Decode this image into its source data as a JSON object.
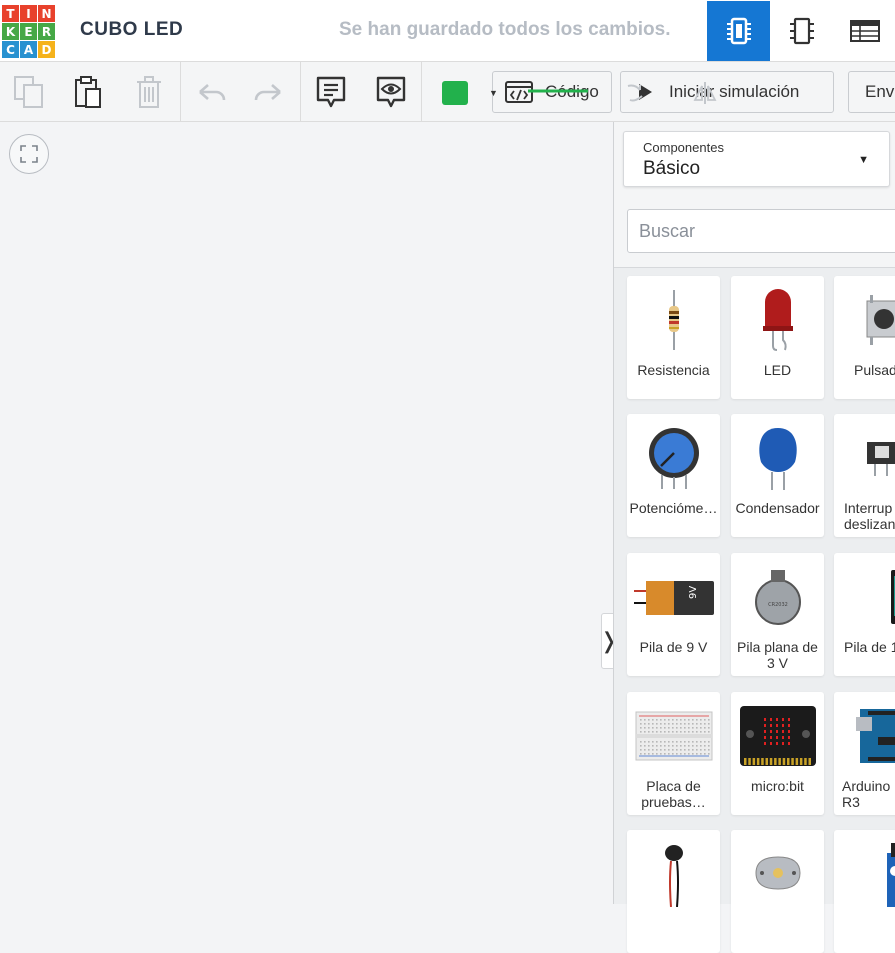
{
  "app": {
    "logo_letters": [
      "T",
      "I",
      "N",
      "K",
      "E",
      "R",
      "C",
      "A",
      "D"
    ],
    "logo_colors": [
      "#e8412c",
      "#e8412c",
      "#e8412c",
      "#46a846",
      "#46a846",
      "#46a846",
      "#2891d0",
      "#2891d0",
      "#f5b21b"
    ],
    "title": "CUBO LED",
    "save_status": "Se han guardado todos los cambios.",
    "accent": "#1577d3"
  },
  "view_switcher": [
    {
      "icon": "circuit-chip-icon",
      "active": true
    },
    {
      "icon": "schematic-icon",
      "active": false
    },
    {
      "icon": "component-list-icon",
      "active": false
    }
  ],
  "toolbar": {
    "copy_icon": "copy-icon",
    "paste_icon": "paste-icon",
    "delete_icon": "trash-icon",
    "undo_icon": "undo-icon",
    "redo_icon": "redo-icon",
    "notes_icon": "notes-icon",
    "visibility_icon": "eye-icon",
    "wire_color": "#22b14c",
    "code_label": "Código",
    "simulate_label": "Iniciar simulación",
    "send_label": "Env"
  },
  "panel": {
    "components_label": "Componentes",
    "category": "Básico",
    "search_placeholder": "Buscar"
  },
  "components": [
    {
      "name": "Resistencia",
      "icon": "resistor-icon"
    },
    {
      "name": "LED",
      "icon": "led-icon"
    },
    {
      "name": "Pulsad",
      "icon": "pushbutton-icon"
    },
    {
      "name": "Potencióme…",
      "icon": "potentiometer-icon"
    },
    {
      "name": "Condensador",
      "icon": "capacitor-icon"
    },
    {
      "name": "Interrup\ndeslizan",
      "icon": "slide-switch-icon"
    },
    {
      "name": "Pila de 9 V",
      "icon": "battery-9v-icon"
    },
    {
      "name": "Pila plana de\n3 V",
      "icon": "coin-cell-icon"
    },
    {
      "name": "Pila de 1",
      "icon": "battery-aa-icon"
    },
    {
      "name": "Placa de\npruebas…",
      "icon": "breadboard-icon"
    },
    {
      "name": "micro:bit",
      "icon": "microbit-icon"
    },
    {
      "name": "Arduino\nR3",
      "icon": "arduino-icon"
    },
    {
      "name": "",
      "icon": "vibration-motor-icon"
    },
    {
      "name": "",
      "icon": "dc-motor-icon"
    },
    {
      "name": "",
      "icon": "servo-icon"
    }
  ]
}
